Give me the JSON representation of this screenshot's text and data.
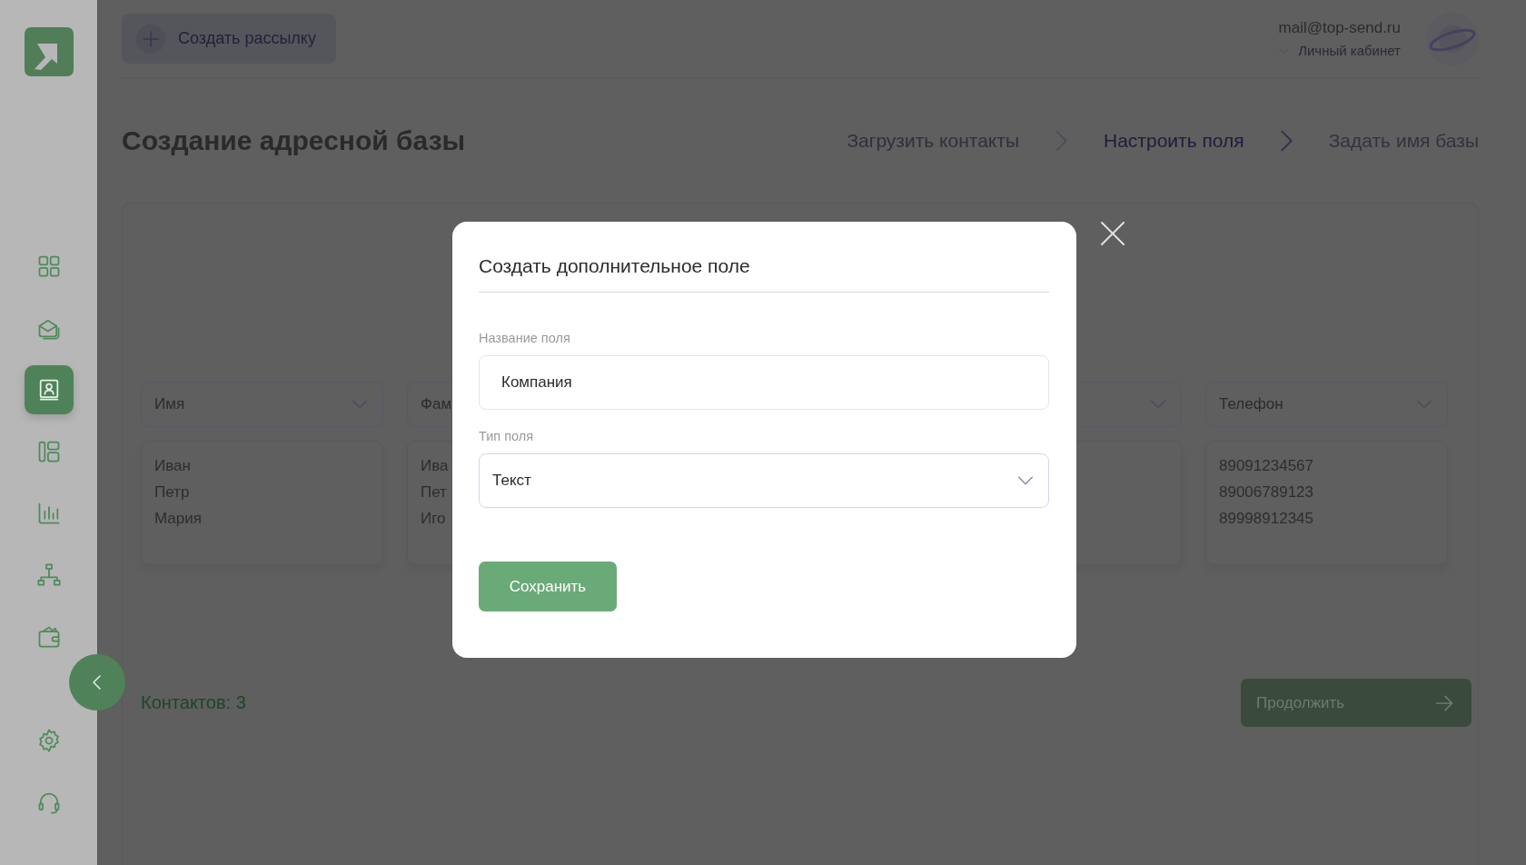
{
  "sidebar": {
    "items": [
      {
        "kind": "grid",
        "selected": false
      },
      {
        "kind": "mail",
        "selected": false
      },
      {
        "kind": "contacts",
        "selected": true
      },
      {
        "kind": "layout",
        "selected": false
      },
      {
        "kind": "stats",
        "selected": false
      },
      {
        "kind": "tree",
        "selected": false
      },
      {
        "kind": "wallet",
        "selected": false
      }
    ],
    "bottom_items": [
      {
        "kind": "settings",
        "selected": false
      },
      {
        "kind": "support",
        "selected": false
      }
    ]
  },
  "header": {
    "create_button": "Создать рассылку",
    "account": {
      "email": "mail@top-send.ru",
      "link": "Личный кабинет"
    }
  },
  "page_title": "Создание адресной базы",
  "steps": [
    {
      "label": "Загрузить контакты",
      "selected": false
    },
    {
      "label": "Настроить поля",
      "selected": true
    },
    {
      "label": "Задать имя базы",
      "selected": false
    }
  ],
  "columns": [
    {
      "kind": "column",
      "header": "Имя",
      "values": [
        "Иван",
        "Петр",
        "Мария"
      ]
    },
    {
      "kind": "column",
      "header": "Фам",
      "values": [
        "Ива",
        "Пет",
        "Иго"
      ]
    },
    {
      "kind": "covered"
    },
    {
      "kind": "column",
      "header": "Телефон",
      "values": [
        "89091234567",
        "89006789123",
        "89998912345"
      ]
    }
  ],
  "contacts_count": "Контактов: 3",
  "continue_button": "Продолжить",
  "modal": {
    "title": "Создать дополнительное поле",
    "name_field": {
      "label": "Название поля",
      "value": "Компания"
    },
    "type_field": {
      "label": "Тип поля",
      "value": "Текст"
    },
    "save_button": "Сохранить"
  }
}
